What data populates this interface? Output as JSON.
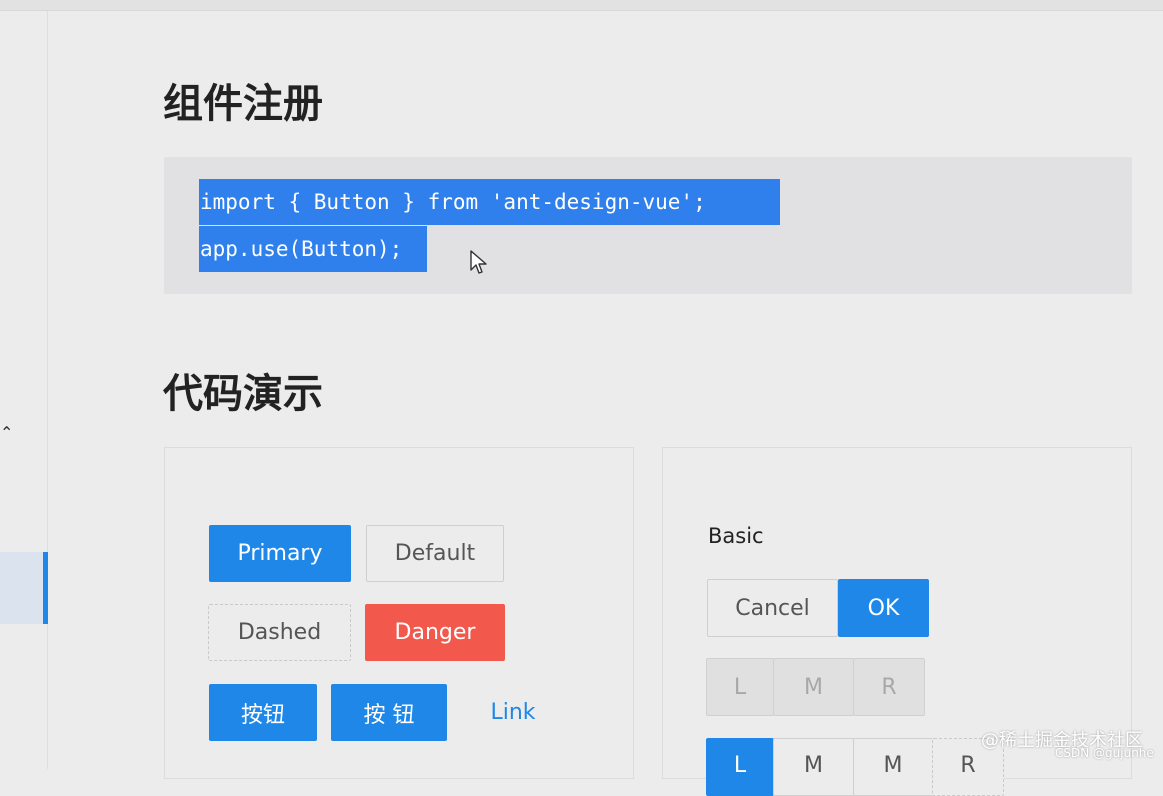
{
  "headings": {
    "registration": "组件注册",
    "demo": "代码演示"
  },
  "code": {
    "line1": "import { Button } from 'ant-design-vue';",
    "line2": "app.use(Button);"
  },
  "demo_left": {
    "primary": "Primary",
    "default": "Default",
    "dashed": "Dashed",
    "danger": "Danger",
    "button1": "按钮",
    "button2": "按 钮",
    "link": "Link"
  },
  "demo_right": {
    "basic_label": "Basic",
    "cancel": "Cancel",
    "ok": "OK",
    "group2": [
      "L",
      "M",
      "R"
    ],
    "group3": [
      "L",
      "M",
      "M",
      "R"
    ]
  },
  "sidebar": {
    "chevron_icon": "chevron-up-icon"
  },
  "watermark": {
    "line1": "@稀土掘金技术社区",
    "line2": "CSDN @gujunhe"
  },
  "colors": {
    "primary": "#1f87e8",
    "danger": "#f2584c",
    "selection": "#2f80ec"
  }
}
